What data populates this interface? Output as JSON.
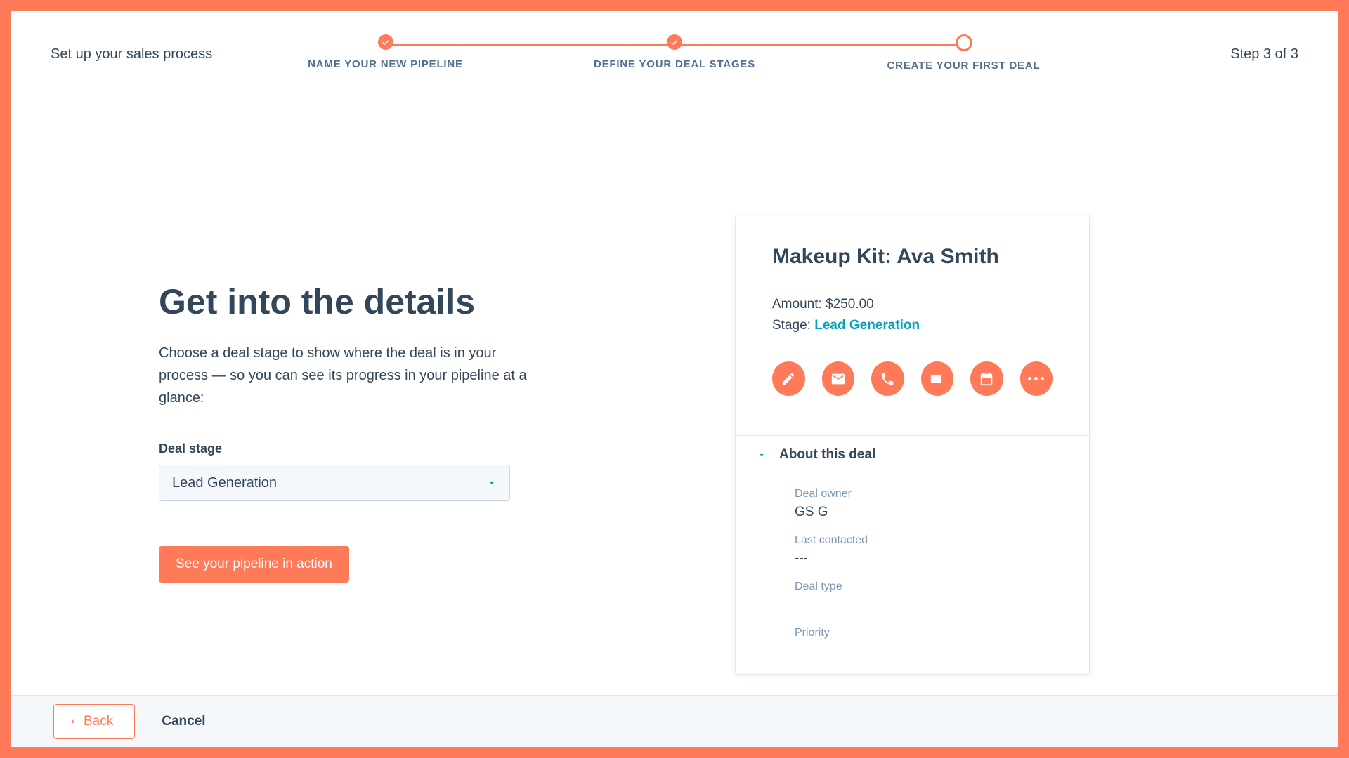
{
  "header": {
    "title_left": "Set up your sales process",
    "step_indicator": "Step 3 of 3",
    "steps": [
      {
        "label": "NAME YOUR NEW PIPELINE",
        "state": "done"
      },
      {
        "label": "DEFINE YOUR DEAL STAGES",
        "state": "done"
      },
      {
        "label": "CREATE YOUR FIRST DEAL",
        "state": "current"
      }
    ]
  },
  "main": {
    "title": "Get into the details",
    "subtitle": "Choose a deal stage to show where the deal is in your process — so you can see its progress in your pipeline at a glance:",
    "field_label": "Deal stage",
    "selected_stage": "Lead Generation",
    "cta_label": "See your pipeline in action"
  },
  "card": {
    "deal_title": "Makeup Kit: Ava Smith",
    "amount_label": "Amount:",
    "amount_value": "$250.00",
    "stage_label": "Stage:",
    "stage_value": "Lead Generation",
    "about_heading": "About this deal",
    "fields": {
      "owner_label": "Deal owner",
      "owner_value": "GS G",
      "last_contacted_label": "Last contacted",
      "last_contacted_value": "---",
      "type_label": "Deal type",
      "priority_label": "Priority"
    },
    "action_icons": [
      "edit-icon",
      "email-icon",
      "phone-icon",
      "video-icon",
      "calendar-icon",
      "more-icon"
    ]
  },
  "footer": {
    "back_label": "Back",
    "cancel_label": "Cancel"
  },
  "colors": {
    "accent": "#ff7a59",
    "link": "#00a4bd"
  }
}
